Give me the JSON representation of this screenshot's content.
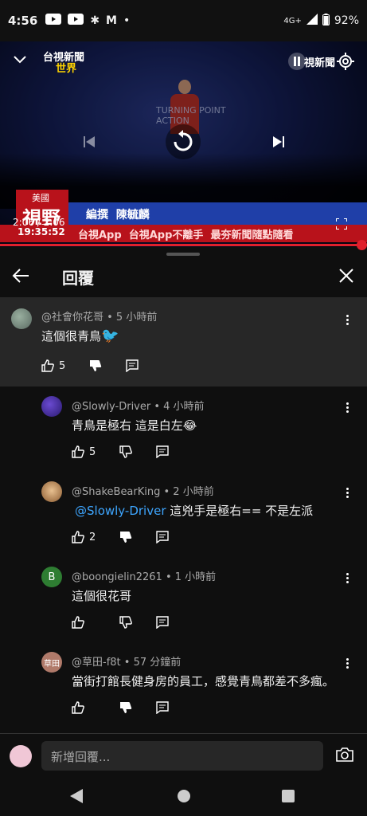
{
  "status_bar": {
    "time": "4:56",
    "network": "4G+",
    "battery": "92%"
  },
  "video": {
    "channel_logo_line1": "台視新聞",
    "channel_logo_line2": "世界",
    "corner_text": "視新聞",
    "podium_text": "TURNING POINT ACTION",
    "region_tag": "美國",
    "show_name": "視野",
    "editor_credit": "編撰  陳毓麟",
    "ticker": "台視App  台視App不離手  最夯新聞隨點隨看",
    "elapsed": "2:06 / 2:06",
    "clock": "19:35:52",
    "progress": 1.0
  },
  "panel": {
    "title": "回覆"
  },
  "comments": [
    {
      "author": "@社會你花哥 • 5 小時前",
      "text": "這個很青鳥",
      "emoji": "🐦",
      "likes": "5"
    },
    {
      "author": "@Slowly-Driver • 4 小時前",
      "text": "青鳥是極右 這是白左",
      "emoji": "😂",
      "likes": "5"
    },
    {
      "author": "@ShakeBearKing • 2 小時前",
      "mention": "@Slowly-Driver",
      "text": " 這兇手是極右== 不是左派",
      "likes": "2"
    },
    {
      "author": "@boongielin2261 • 1 小時前",
      "avatar_letter": "B",
      "text": "這個很花哥",
      "likes": ""
    },
    {
      "author": "@草田-f8t • 57 分鐘前",
      "avatar_text": "草田",
      "text": "當街打館長健身房的員工，感覺青鳥都差不多瘋。",
      "likes": ""
    }
  ],
  "input": {
    "placeholder": "新增回覆..."
  },
  "colors": {
    "background": "#0f0f0f",
    "highlight": "#272727",
    "mention": "#3ea6ff",
    "progress": "#e0202c"
  }
}
